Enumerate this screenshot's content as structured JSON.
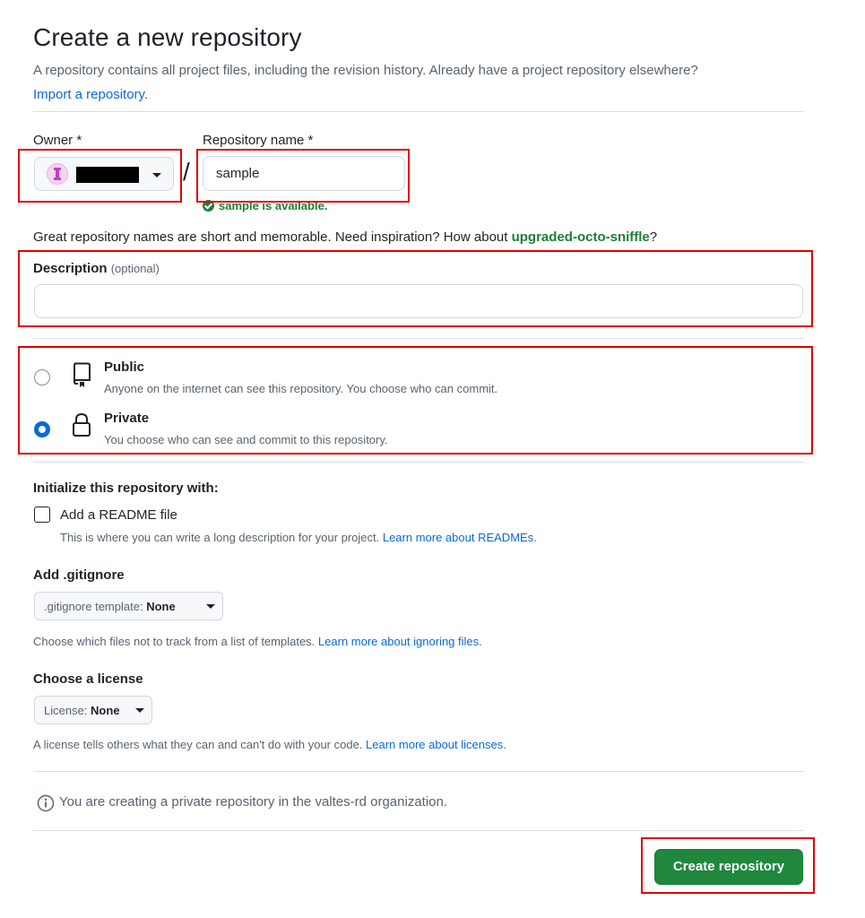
{
  "header": {
    "title": "Create a new repository",
    "subtitle": "A repository contains all project files, including the revision history. Already have a project repository elsewhere?",
    "import_link": "Import a repository",
    "import_suffix": "."
  },
  "owner": {
    "label": "Owner *",
    "avatar_icon": "org-avatar-icon",
    "caret_icon": "triangle-down-icon"
  },
  "repo_name": {
    "label": "Repository name *",
    "value": "sample",
    "availability": "sample is available.",
    "availability_icon": "check-circle-fill-icon",
    "separator": "/"
  },
  "suggestion": {
    "prefix": "Great repository names are short and memorable. Need inspiration? How about ",
    "name": "upgraded-octo-sniffle",
    "suffix": "?"
  },
  "description": {
    "label": "Description",
    "optional": "(optional)",
    "value": ""
  },
  "visibility": {
    "options": [
      {
        "title": "Public",
        "sub": "Anyone on the internet can see this repository. You choose who can commit.",
        "icon": "repo-icon",
        "selected": false
      },
      {
        "title": "Private",
        "sub": "You choose who can see and commit to this repository.",
        "icon": "lock-icon",
        "selected": true
      }
    ]
  },
  "initialize": {
    "heading": "Initialize this repository with:",
    "readme_label": "Add a README file",
    "readme_checked": false,
    "readme_help": "This is where you can write a long description for your project. ",
    "readme_link": "Learn more about READMEs",
    "readme_suffix": "."
  },
  "gitignore": {
    "heading": "Add .gitignore",
    "select_prefix": ".gitignore template: ",
    "select_value": "None",
    "help": "Choose which files not to track from a list of templates. ",
    "link": "Learn more about ignoring files",
    "suffix": "."
  },
  "license": {
    "heading": "Choose a license",
    "select_prefix": "License: ",
    "select_value": "None",
    "help": "A license tells others what they can and can't do with your code. ",
    "link": "Learn more about licenses",
    "suffix": "."
  },
  "notice": {
    "icon": "info-icon",
    "text": "You are creating a private repository in the valtes-rd organization."
  },
  "submit": {
    "label": "Create repository"
  },
  "colors": {
    "accent": "#0969da",
    "success": "#1a7f37",
    "primary_button": "#1f883d",
    "annotation_red": "#e00000"
  }
}
